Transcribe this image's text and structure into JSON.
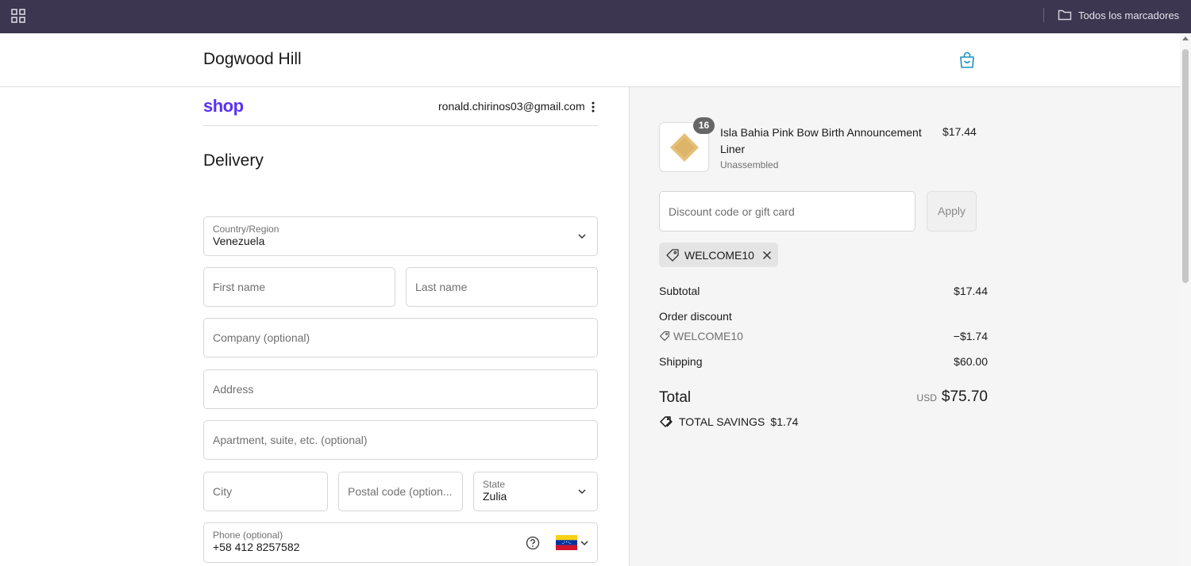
{
  "browser": {
    "bookmarks_folder": "Todos los marcadores"
  },
  "header": {
    "store_name": "Dogwood Hill"
  },
  "account": {
    "shop_logo": "shop",
    "email": "ronald.chirinos03@gmail.com"
  },
  "delivery": {
    "heading": "Delivery",
    "country": {
      "label": "Country/Region",
      "value": "Venezuela"
    },
    "first_name": {
      "placeholder": "First name"
    },
    "last_name": {
      "placeholder": "Last name"
    },
    "company": {
      "placeholder": "Company (optional)"
    },
    "address": {
      "placeholder": "Address"
    },
    "apartment": {
      "placeholder": "Apartment, suite, etc. (optional)"
    },
    "city": {
      "placeholder": "City"
    },
    "postal_code": {
      "placeholder": "Postal code (option..."
    },
    "state": {
      "label": "State",
      "value": "Zulia"
    },
    "phone": {
      "label": "Phone (optional)",
      "value": "+58 412 8257582"
    }
  },
  "summary": {
    "product": {
      "quantity": "16",
      "name": "Isla Bahia Pink Bow Birth Announcement Liner",
      "variant": "Unassembled",
      "price": "$17.44"
    },
    "discount_input": {
      "placeholder": "Discount code or gift card"
    },
    "apply_label": "Apply",
    "applied_code": "WELCOME10",
    "subtotal": {
      "label": "Subtotal",
      "value": "$17.44"
    },
    "order_discount": {
      "label": "Order discount",
      "code": "WELCOME10",
      "value": "−$1.74"
    },
    "shipping": {
      "label": "Shipping",
      "value": "$60.00"
    },
    "total": {
      "label": "Total",
      "currency": "USD",
      "value": "$75.70"
    },
    "savings": {
      "label": "TOTAL SAVINGS",
      "value": "$1.74"
    }
  },
  "colors": {
    "bookmarks_bar": "#3c3650",
    "shop_brand": "#5a31f4",
    "cart_icon": "#1a8fbf",
    "summary_bg": "#f5f5f5"
  }
}
